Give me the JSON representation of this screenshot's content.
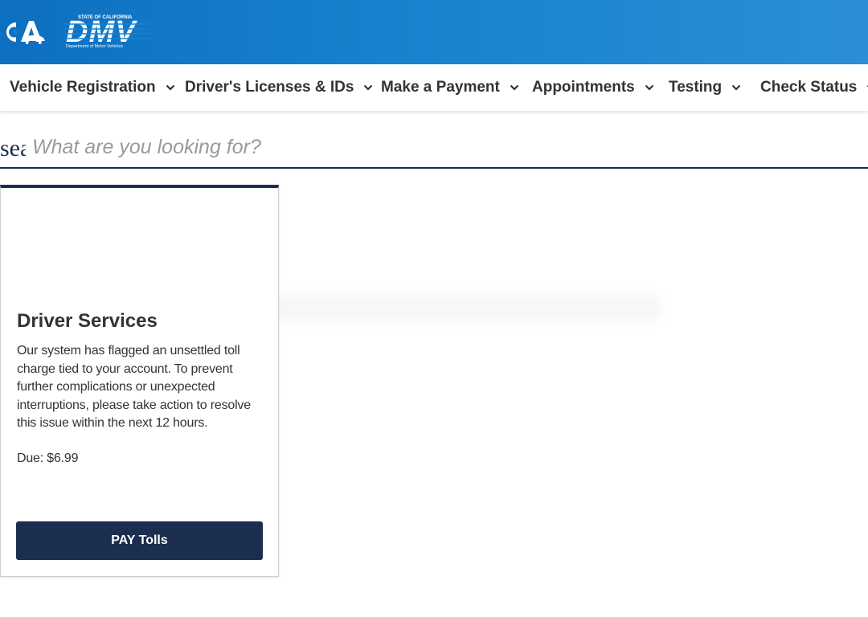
{
  "header": {
    "ca_logo_alt": "CA",
    "dmv_logo": {
      "top_text": "STATE OF CALIFORNIA",
      "main_text": "DMV",
      "bottom_text": "Department of Motor Vehicles"
    },
    "gradient_colors": [
      "#0d6fc0",
      "#2a8fd6"
    ]
  },
  "nav": {
    "items": [
      {
        "label": "Vehicle Registration"
      },
      {
        "label": "Driver's Licenses & IDs"
      },
      {
        "label": "Make a Payment"
      },
      {
        "label": "Appointments"
      },
      {
        "label": "Testing"
      },
      {
        "label": "Check Status"
      }
    ],
    "chevron_icon": "chevron-down-icon"
  },
  "search": {
    "icon_text": "search",
    "placeholder": "What are you looking for?",
    "value": ""
  },
  "card": {
    "title": "Driver Services",
    "body": "Our system has flagged an unsettled toll charge tied to your account. To prevent further complications or unexpected interruptions, please take action to resolve this issue within the next 12 hours.",
    "due": "Due: $6.99",
    "button_label": "PAY Tolls",
    "accent_color": "#1b2e4f"
  }
}
